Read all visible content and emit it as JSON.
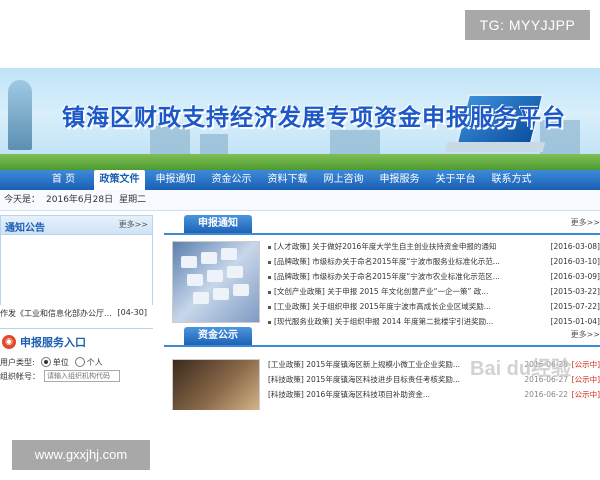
{
  "watermarks": {
    "top": "TG: MYYJJPP",
    "bottom": "www.gxxjhj.com",
    "baidu": "Bai du经验"
  },
  "banner": {
    "title": "镇海区财政支持经济发展专项资金申报服务平台"
  },
  "nav": {
    "items": [
      "首 页",
      "政策文件",
      "申报通知",
      "资金公示",
      "资料下载",
      "网上咨询",
      "申报服务",
      "关于平台",
      "联系方式"
    ],
    "active_index": 1
  },
  "datebar": {
    "label": "今天是：",
    "date": "2016年6月28日",
    "weekday": "星期二"
  },
  "notice": {
    "title": "通知公告",
    "more": "更多>>",
    "items": [
      {
        "text": "作发《工业和信息化部办公厅...",
        "date": "[04-30]"
      }
    ]
  },
  "entry": {
    "title": "申报服务入口",
    "user_type_label": "用户类型:",
    "options": [
      "单位",
      "个人"
    ],
    "selected": 0,
    "account_label": "组织帐号：",
    "account_placeholder": "请输入组织机构代码"
  },
  "apply_notice": {
    "tab": "申报通知",
    "more": "更多>>",
    "items": [
      {
        "text": "[人才政策] 关于做好2016年度大学生自主创业扶持资金申报的通知",
        "date": "[2016-03-08]"
      },
      {
        "text": "[品牌政策] 市级标办关于命名2015年度“宁波市服务业标准化示范...",
        "date": "[2016-03-10]"
      },
      {
        "text": "[品牌政策] 市级标办关于命名2015年度“宁波市农业标准化示范区...",
        "date": "[2016-03-09]"
      },
      {
        "text": "[文创产业政策] 关于申报 2015 年文化创意产业“一企一策” 政...",
        "date": "[2015-03-22]"
      },
      {
        "text": "[工业政策] 关于组织申报 2015年度宁波市高成长企业区域奖励...",
        "date": "[2015-07-22]"
      },
      {
        "text": "[现代服务业政策] 关于组织申报 2014 年度第二批楼宇引进奖励...",
        "date": "[2015-01-04]"
      }
    ]
  },
  "fund_notice": {
    "tab": "资金公示",
    "more": "更多>>",
    "items": [
      {
        "text": "[工业政策] 2015年度镇海区新上规模小微工业企业奖励...",
        "date": "2016-06-28",
        "status": "[公示中]"
      },
      {
        "text": "[科技政策] 2015年度镇海区科技进步目标责任考核奖励...",
        "date": "2016-06-27",
        "status": "[公示中]"
      },
      {
        "text": "[科技政策] 2016年度镇海区科技项目补助资金...",
        "date": "2016-06-22",
        "status": "[公示中]"
      }
    ]
  }
}
